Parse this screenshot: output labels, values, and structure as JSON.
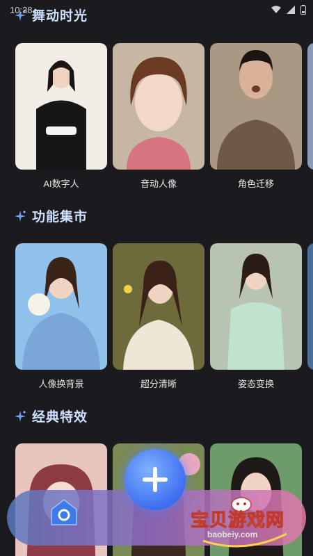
{
  "status": {
    "time": "10:38"
  },
  "sections": [
    {
      "title": "舞动时光",
      "cards": [
        {
          "label": "AI数字人"
        },
        {
          "label": "音动人像"
        },
        {
          "label": "角色迁移"
        }
      ]
    },
    {
      "title": "功能集市",
      "cards": [
        {
          "label": "人像换背景"
        },
        {
          "label": "超分清晰"
        },
        {
          "label": "姿态变换"
        }
      ]
    },
    {
      "title": "经典特效",
      "cards": [
        {
          "label": ""
        },
        {
          "label": ""
        },
        {
          "label": ""
        }
      ]
    }
  ],
  "watermark": {
    "text": "宝贝游戏网",
    "url": "baobeiy.com"
  },
  "colors": {
    "accent": "#3f6ff0",
    "title": "#cfe0ff",
    "background": "#1a1a1f"
  }
}
